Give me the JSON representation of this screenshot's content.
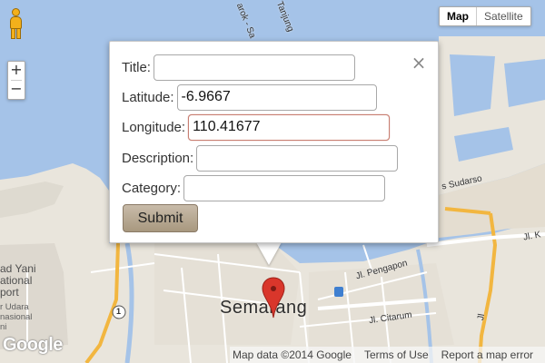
{
  "map": {
    "type_buttons": [
      "Map",
      "Satellite"
    ],
    "active_type": "Map",
    "zoom_in_label": "+",
    "zoom_out_label": "−",
    "city_label": "Semarang",
    "road_labels": {
      "tanjung": "Tanjung",
      "arok": "arok - Sa",
      "sudarso": "s Sudarso",
      "pengapon": "Jl. Pengapon",
      "citarum": "Jl. Citarum",
      "jl_k": "Jl. K",
      "jl_vertical": "Jl",
      "route_shield": "1"
    },
    "airport_label_lines": [
      "ad Yani",
      "ational",
      "port"
    ],
    "airport_small_lines": [
      "r Udara",
      "nasional",
      "ni"
    ],
    "colors": {
      "water": "#a5c3e8",
      "land": "#e9e5dc",
      "road_major": "#f2b640",
      "road_minor": "#ffffff",
      "marker": "#d9362b"
    }
  },
  "info_window": {
    "close_label": "×",
    "fields": {
      "title": {
        "label": "Title:",
        "value": ""
      },
      "latitude": {
        "label": "Latitude:",
        "value": "-6.9667"
      },
      "longitude": {
        "label": "Longitude:",
        "value": "110.41677"
      },
      "description": {
        "label": "Description:",
        "value": ""
      },
      "category": {
        "label": "Category:",
        "value": ""
      }
    },
    "submit_label": "Submit"
  },
  "footer": {
    "logo_text": "Google",
    "map_data": "Map data ©2014 Google",
    "terms": "Terms of Use",
    "report": "Report a map error"
  },
  "icons": {
    "pegman": "pegman-icon",
    "marker": "map-marker-icon",
    "close": "close-icon",
    "transit": "transit-icon"
  }
}
